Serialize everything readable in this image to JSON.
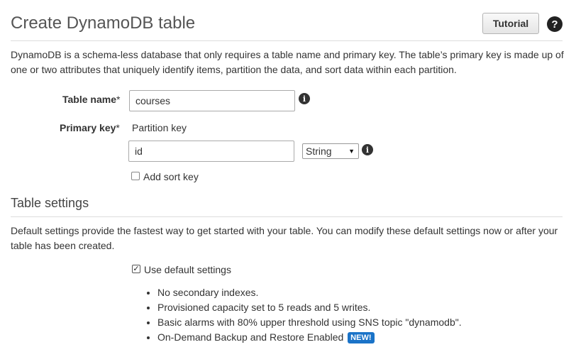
{
  "header": {
    "title": "Create DynamoDB table",
    "tutorial_label": "Tutorial",
    "help_glyph": "?"
  },
  "intro_text": "DynamoDB is a schema-less database that only requires a table name and primary key. The table’s primary key is made up of one or two attributes that uniquely identify items, partition the data, and sort data within each partition.",
  "form": {
    "table_name_label": "Table name",
    "table_name_value": "courses",
    "required_mark": "*",
    "primary_key_label": "Primary key",
    "partition_key_label": "Partition key",
    "partition_key_value": "id",
    "partition_key_type": "String",
    "add_sort_key_label": "Add sort key",
    "add_sort_key_checked": false
  },
  "table_settings": {
    "title": "Table settings",
    "description": "Default settings provide the fastest way to get started with your table. You can modify these default settings now or after your table has been created.",
    "use_default_label": "Use default settings",
    "use_default_checked": true,
    "defaults": [
      "No secondary indexes.",
      "Provisioned capacity set to 5 reads and 5 writes.",
      "Basic alarms with 80% upper threshold using SNS topic \"dynamodb\".",
      "On-Demand Backup and Restore Enabled"
    ],
    "new_badge": "NEW!"
  },
  "icons": {
    "info": "info-icon",
    "help": "help-icon",
    "caret": "chevron-down-icon"
  },
  "colors": {
    "badge_blue": "#1a73c8",
    "title_gray": "#555555"
  }
}
